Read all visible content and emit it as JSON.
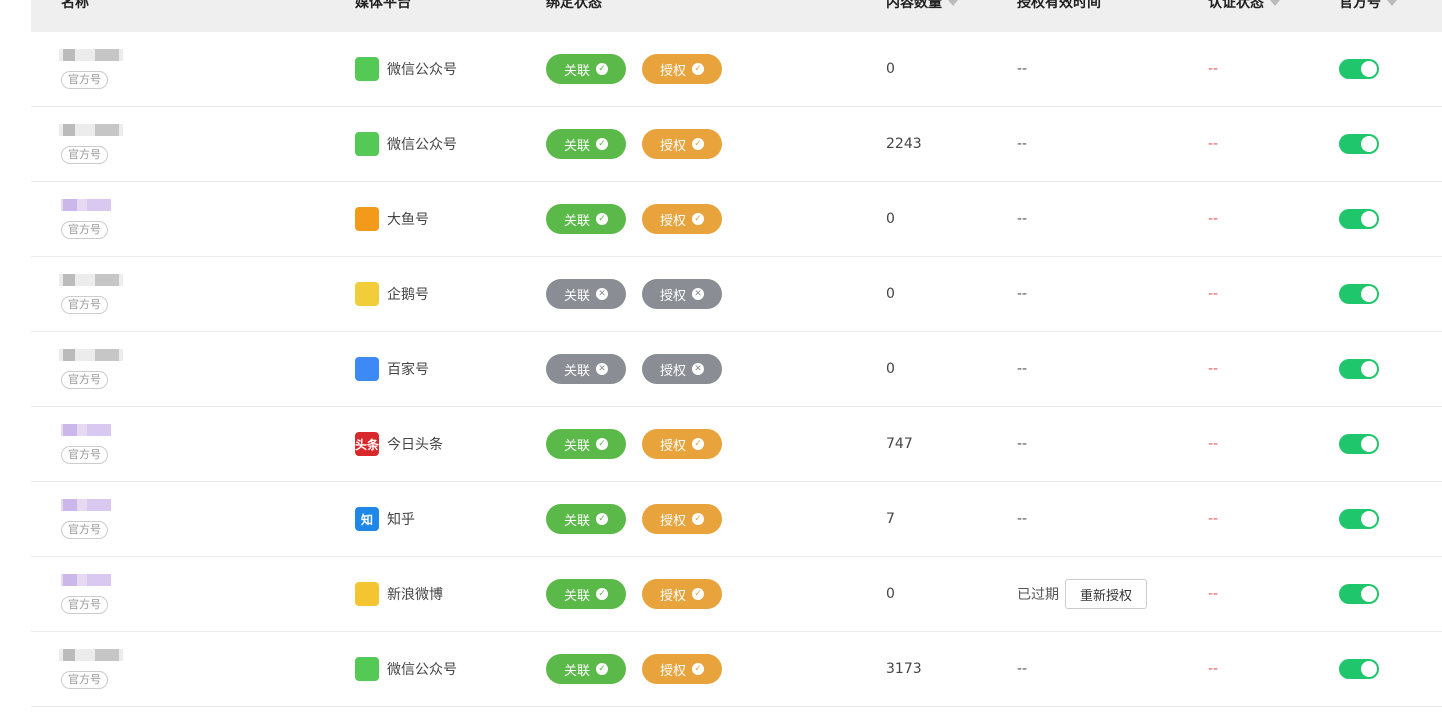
{
  "header": {
    "name": "名称",
    "platform": "媒体平台",
    "bind_status": "绑定状态",
    "content_count": "内容数量",
    "auth_valid": "授权有效时间",
    "verify_status": "认证状态",
    "official": "官方号"
  },
  "labels": {
    "link": "关联",
    "auth": "授权",
    "official_tag": "官方号",
    "reauth_button": "重新授权"
  },
  "colors": {
    "green": "#5bb94a",
    "orange": "#e8a33d",
    "grey": "#8a8d94",
    "toggle_on": "#1fc66b",
    "verify": "#e15b5b"
  },
  "rows": [
    {
      "platform": "微信公众号",
      "icon": "wechat-icon",
      "icon_text": "",
      "icon_color": "#55c956",
      "link_ok": true,
      "auth_ok": true,
      "count": "0",
      "valid": "--",
      "valid_expired": false,
      "verify": "--",
      "official_on": true,
      "mosaic": "grey"
    },
    {
      "platform": "微信公众号",
      "icon": "wechat-icon",
      "icon_text": "",
      "icon_color": "#55c956",
      "link_ok": true,
      "auth_ok": true,
      "count": "2243",
      "valid": "--",
      "valid_expired": false,
      "verify": "--",
      "official_on": true,
      "mosaic": "grey"
    },
    {
      "platform": "大鱼号",
      "icon": "dayu-icon",
      "icon_text": "",
      "icon_color": "#f39a1b",
      "link_ok": true,
      "auth_ok": true,
      "count": "0",
      "valid": "--",
      "valid_expired": false,
      "verify": "--",
      "official_on": true,
      "mosaic": "purple"
    },
    {
      "platform": "企鹅号",
      "icon": "penguin-icon",
      "icon_text": "",
      "icon_color": "#f2cd3a",
      "link_ok": false,
      "auth_ok": false,
      "count": "0",
      "valid": "--",
      "valid_expired": false,
      "verify": "--",
      "official_on": true,
      "mosaic": "grey"
    },
    {
      "platform": "百家号",
      "icon": "baijia-icon",
      "icon_text": "",
      "icon_color": "#3d8af7",
      "link_ok": false,
      "auth_ok": false,
      "count": "0",
      "valid": "--",
      "valid_expired": false,
      "verify": "--",
      "official_on": true,
      "mosaic": "grey"
    },
    {
      "platform": "今日头条",
      "icon": "toutiao-icon",
      "icon_text": "头条",
      "icon_color": "#d8282c",
      "link_ok": true,
      "auth_ok": true,
      "count": "747",
      "valid": "--",
      "valid_expired": false,
      "verify": "--",
      "official_on": true,
      "mosaic": "purple"
    },
    {
      "platform": "知乎",
      "icon": "zhihu-icon",
      "icon_text": "知",
      "icon_color": "#1f87e8",
      "link_ok": true,
      "auth_ok": true,
      "count": "7",
      "valid": "--",
      "valid_expired": false,
      "verify": "--",
      "official_on": true,
      "mosaic": "purple"
    },
    {
      "platform": "新浪微博",
      "icon": "weibo-icon",
      "icon_text": "",
      "icon_color": "#f5c531",
      "link_ok": true,
      "auth_ok": true,
      "count": "0",
      "valid": "已过期",
      "valid_expired": true,
      "verify": "--",
      "official_on": true,
      "mosaic": "purple"
    },
    {
      "platform": "微信公众号",
      "icon": "wechat-icon",
      "icon_text": "",
      "icon_color": "#55c956",
      "link_ok": true,
      "auth_ok": true,
      "count": "3173",
      "valid": "--",
      "valid_expired": false,
      "verify": "--",
      "official_on": true,
      "mosaic": "grey"
    }
  ]
}
